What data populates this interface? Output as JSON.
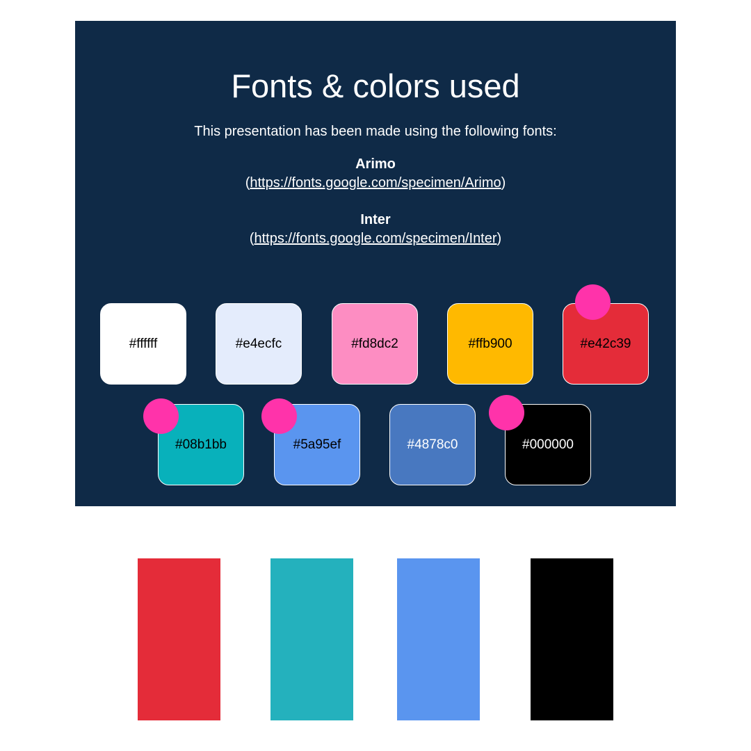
{
  "title": "Fonts & colors used",
  "intro": "This presentation has been made using the following fonts:",
  "fonts": [
    {
      "name": "Arimo",
      "paren_open": "(",
      "url": "https://fonts.google.com/specimen/Arimo",
      "paren_close": ")"
    },
    {
      "name": "Inter",
      "paren_open": "(",
      "url": "https://fonts.google.com/specimen/Inter",
      "paren_close": ")"
    }
  ],
  "swatches": [
    {
      "hex": "#ffffff",
      "bg": "#ffffff",
      "text_color": "#000000"
    },
    {
      "hex": "#e4ecfc",
      "bg": "#e4ecfc",
      "text_color": "#000000"
    },
    {
      "hex": "#fd8dc2",
      "bg": "#fd8dc2",
      "text_color": "#000000"
    },
    {
      "hex": "#ffb900",
      "bg": "#ffb900",
      "text_color": "#000000"
    },
    {
      "hex": "#e42c39",
      "bg": "#e42c39",
      "text_color": "#000000"
    },
    {
      "hex": "#08b1bb",
      "bg": "#08b1bb",
      "text_color": "#000000"
    },
    {
      "hex": "#5a95ef",
      "bg": "#5a95ef",
      "text_color": "#000000"
    },
    {
      "hex": "#4878c0",
      "bg": "#4878c0",
      "text_color": "#ffffff"
    },
    {
      "hex": "#000000",
      "bg": "#000000",
      "text_color": "#ffffff"
    }
  ],
  "marker_color": "#ff33aa",
  "slide_bg": "#0f2a47",
  "bars": [
    {
      "color": "#e42c39"
    },
    {
      "color": "#24b1bd"
    },
    {
      "color": "#5a95ef"
    },
    {
      "color": "#000000"
    }
  ]
}
